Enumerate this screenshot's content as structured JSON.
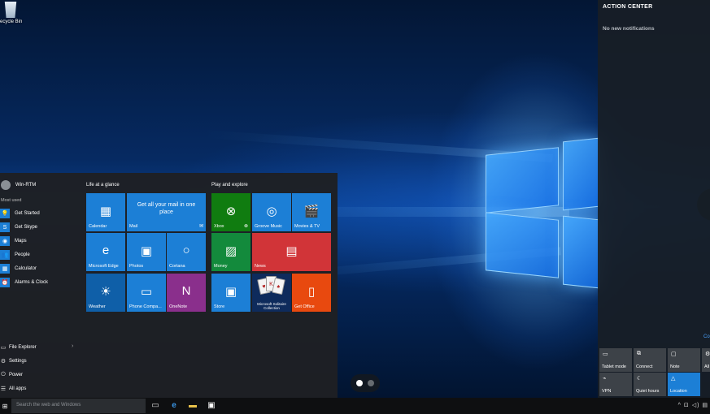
{
  "desktop": {
    "recycle_bin_label": "ecycle Bin"
  },
  "action_center": {
    "title": "ACTION CENTER",
    "empty_message": "No new notifications",
    "collapse_label": "Co",
    "quick_actions": [
      {
        "label": "Tablet mode",
        "icon": "tablet-mode-icon",
        "active": false
      },
      {
        "label": "Connect",
        "icon": "connect-icon",
        "active": false
      },
      {
        "label": "Note",
        "icon": "note-icon",
        "active": false
      },
      {
        "label": "All",
        "icon": "settings-icon",
        "active": false
      },
      {
        "label": "VPN",
        "icon": "vpn-icon",
        "active": false
      },
      {
        "label": "Quiet hours",
        "icon": "moon-icon",
        "active": false
      },
      {
        "label": "Location",
        "icon": "location-icon",
        "active": true
      }
    ]
  },
  "start_menu": {
    "user_name": "Win-RTM",
    "most_used_label": "Most used",
    "most_used": [
      {
        "label": "Get Started",
        "icon": "lightbulb-icon"
      },
      {
        "label": "Get Skype",
        "icon": "skype-icon"
      },
      {
        "label": "Maps",
        "icon": "maps-icon"
      },
      {
        "label": "People",
        "icon": "people-icon"
      },
      {
        "label": "Calculator",
        "icon": "calculator-icon"
      },
      {
        "label": "Alarms & Clock",
        "icon": "alarm-icon"
      }
    ],
    "bottom": {
      "file_explorer": "File Explorer",
      "settings": "Settings",
      "power": "Power",
      "all_apps": "All apps"
    },
    "groups": {
      "life": "Life at a glance",
      "play": "Play and explore"
    },
    "tiles": {
      "calendar": "Calendar",
      "mail": "Mail",
      "mail_message": "Get all your mail in one place",
      "edge": "Microsoft Edge",
      "photos": "Photos",
      "cortana": "Cortana",
      "weather": "Weather",
      "phone": "Phone Compa...",
      "onenote": "OneNote",
      "xbox": "Xbox",
      "groove": "Groove Music",
      "movies": "Movies & TV",
      "money": "Money",
      "news": "News",
      "store": "Store",
      "solitaire": "Microsoft Solitaire Collection",
      "office": "Get Office"
    }
  },
  "taskbar": {
    "search_placeholder": "Search the web and Windows"
  },
  "colors": {
    "accent": "#1c7fd6",
    "xbox_green": "#107c10",
    "money_green": "#138a3c",
    "news_red": "#d13438",
    "office_orange": "#e8490f",
    "onenote_purple": "#8a2f8c",
    "weather_blue": "#0f5fa8"
  }
}
